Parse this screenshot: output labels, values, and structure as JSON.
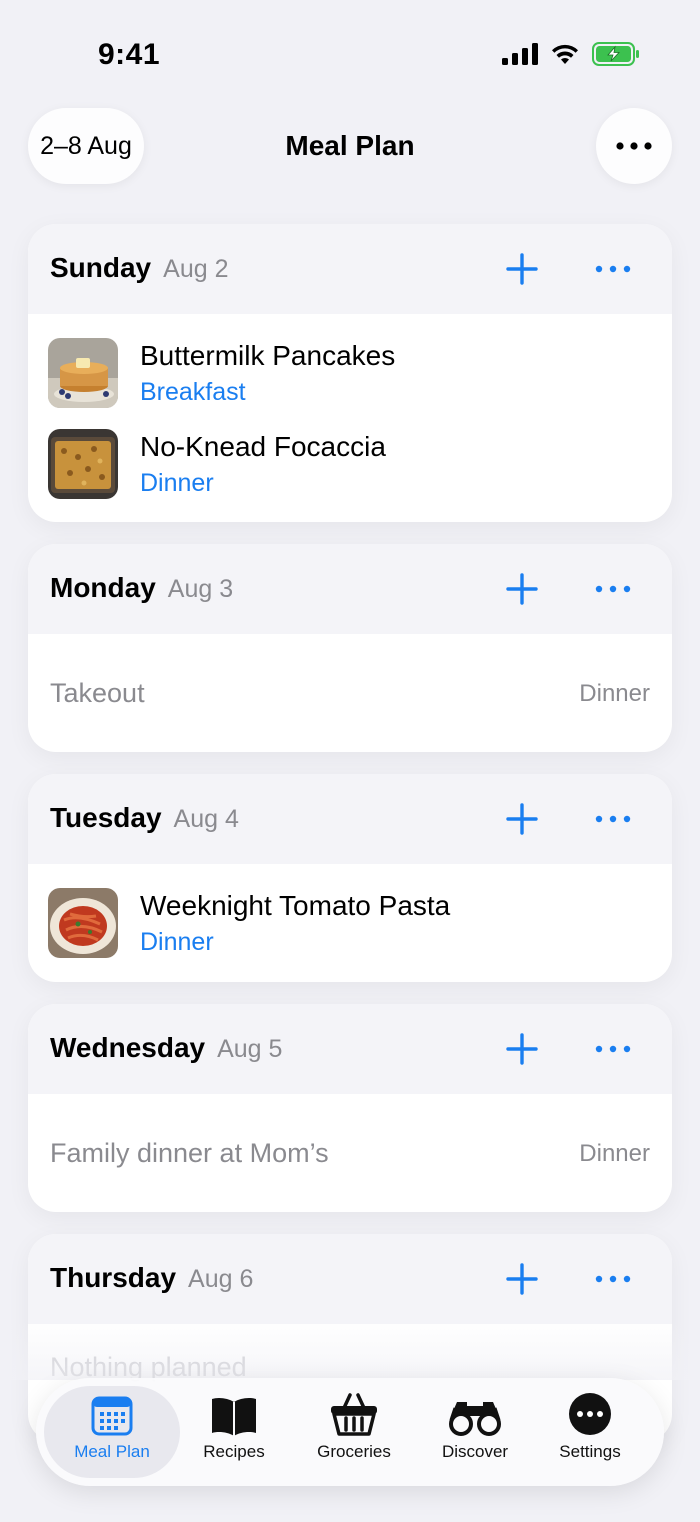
{
  "status_bar": {
    "time": "9:41"
  },
  "header": {
    "week_range": "2–8 Aug",
    "title": "Meal Plan"
  },
  "days": [
    {
      "name": "Sunday",
      "date": "Aug 2",
      "meals": [
        {
          "title": "Buttermilk Pancakes",
          "type": "Breakfast",
          "thumb": "pancakes-photo"
        },
        {
          "title": "No-Knead Focaccia",
          "type": "Dinner",
          "thumb": "focaccia-photo"
        }
      ]
    },
    {
      "name": "Monday",
      "date": "Aug 3",
      "note": {
        "text": "Takeout",
        "type": "Dinner"
      }
    },
    {
      "name": "Tuesday",
      "date": "Aug 4",
      "meals": [
        {
          "title": "Weeknight Tomato Pasta",
          "type": "Dinner",
          "thumb": "pasta-photo"
        }
      ]
    },
    {
      "name": "Wednesday",
      "date": "Aug 5",
      "note": {
        "text": "Family dinner at Mom’s",
        "type": "Dinner"
      }
    },
    {
      "name": "Thursday",
      "date": "Aug 6",
      "note": {
        "text": "Nothing planned",
        "type": ""
      }
    }
  ],
  "tab_bar": {
    "tabs": [
      {
        "label": "Meal Plan",
        "icon": "calendar-icon",
        "active": true
      },
      {
        "label": "Recipes",
        "icon": "book-icon",
        "active": false
      },
      {
        "label": "Groceries",
        "icon": "basket-icon",
        "active": false
      },
      {
        "label": "Discover",
        "icon": "binoculars-icon",
        "active": false
      },
      {
        "label": "Settings",
        "icon": "ellipsis-circle-icon",
        "active": false
      }
    ]
  },
  "colors": {
    "accent": "#1a7ef0",
    "background": "#f1f1f6",
    "secondary_text": "#8a8a8f"
  }
}
